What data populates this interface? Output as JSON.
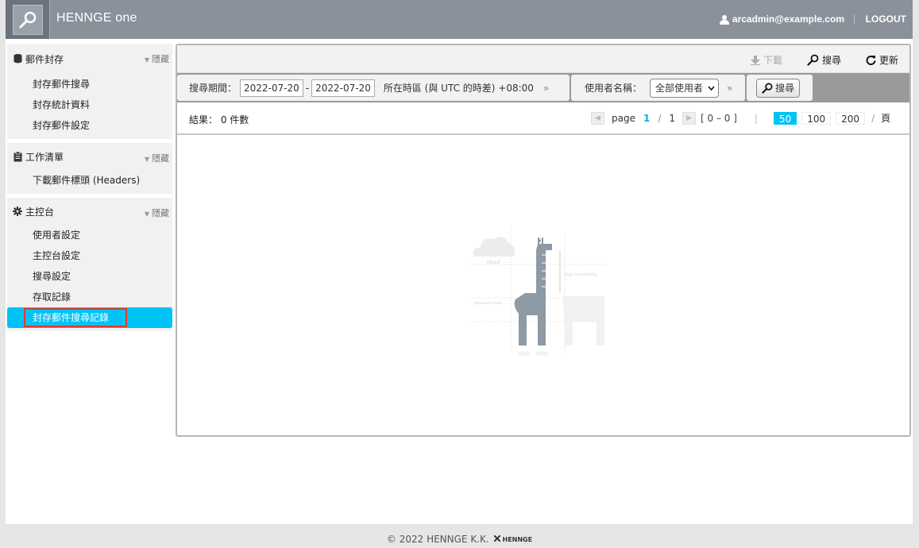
{
  "header": {
    "brand": "HENNGE one",
    "user_email": "arcadmin@example.com",
    "logout": "LOGOUT"
  },
  "sidebar": {
    "hide_label": "隱藏",
    "sections": [
      {
        "title": "郵件封存",
        "icon": "database-icon",
        "items": [
          "封存郵件搜尋",
          "封存統計資料",
          "封存郵件設定"
        ]
      },
      {
        "title": "工作清單",
        "icon": "clipboard-icon",
        "items": [
          "下載郵件標頭 (Headers)"
        ]
      },
      {
        "title": "主控台",
        "icon": "gear-icon",
        "items": [
          "使用者設定",
          "主控台設定",
          "搜尋設定",
          "存取記錄",
          "封存郵件搜尋記錄"
        ]
      }
    ],
    "active_item": "封存郵件搜尋記錄"
  },
  "toolbar": {
    "download": "下載",
    "search": "搜尋",
    "refresh": "更新"
  },
  "filter": {
    "period_label": "搜尋期間：",
    "date_from": "2022-07-20",
    "date_sep": "-",
    "date_to": "2022-07-20",
    "timezone": "所在時區 (與 UTC 的時差) +08:00",
    "user_label": "使用者名稱：",
    "user_select": "全部使用者",
    "search_button": "搜尋"
  },
  "results": {
    "label": "結果： 0 件數",
    "page_label": "page",
    "current_page": "1",
    "slash": "/",
    "total_pages": "1",
    "range": "[ 0 – 0 ]",
    "divider": "|",
    "page_sizes": [
      "50",
      "100",
      "200"
    ],
    "selected_size": "50",
    "per_page_suffix": "頁"
  },
  "footer": {
    "copyright": "© 2022 HENNGE K.K.",
    "logo_text": "HENNGE"
  },
  "colors": {
    "header_bg": "#8b919b",
    "accent": "#00c3f5",
    "highlight_border": "#e03a2e"
  }
}
